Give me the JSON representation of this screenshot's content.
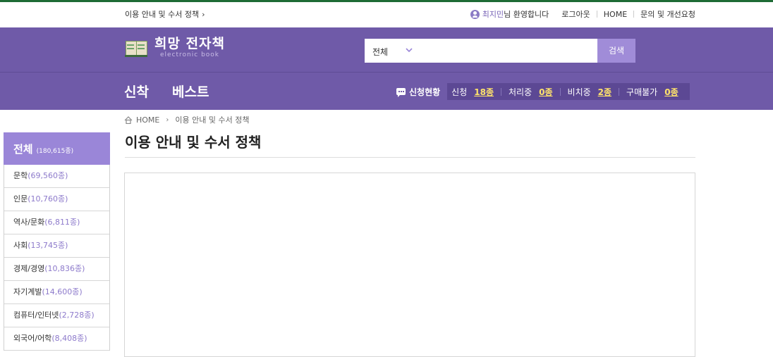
{
  "util": {
    "left_link": "이용 안내 및 수서 정책",
    "left_chevron": "›",
    "user_name": "최지민",
    "user_suffix": "님 환영합니다",
    "logout": "로그아웃",
    "home": "HOME",
    "inquiry": "문의 및 개선요청"
  },
  "header": {
    "logo_title": "희망 전자책",
    "logo_sub": "electronic book",
    "search_scope": "전체",
    "search_placeholder": "",
    "search_button": "검색"
  },
  "nav": {
    "items": [
      "신착",
      "베스트"
    ],
    "request_title": "신청현황",
    "stats": [
      {
        "label": "신청",
        "value": "18종"
      },
      {
        "label": "처리중",
        "value": "0종"
      },
      {
        "label": "비치중",
        "value": "2종"
      },
      {
        "label": "구매불가",
        "value": "0종"
      }
    ]
  },
  "breadcrumb": {
    "home": "HOME",
    "separator": "›",
    "current": "이용 안내 및 수서 정책"
  },
  "page": {
    "title": "이용 안내 및 수서 정책"
  },
  "sidebar": {
    "all_label": "전체",
    "all_count": "(180,615종)",
    "items": [
      {
        "label": "문학",
        "count": "(69,560종)"
      },
      {
        "label": "인문",
        "count": "(10,760종)"
      },
      {
        "label": "역사/문화",
        "count": "(6,811종)"
      },
      {
        "label": "사회",
        "count": "(13,745종)"
      },
      {
        "label": "경제/경영",
        "count": "(10,836종)"
      },
      {
        "label": "자기계발",
        "count": "(14,600종)"
      },
      {
        "label": "컴퓨터/인터넷",
        "count": "(2,728종)"
      },
      {
        "label": "외국어/어학",
        "count": "(8,408종)"
      }
    ]
  },
  "colors": {
    "brand": "#6f5aa8",
    "accent": "#9a86d8",
    "highlight": "#ffe36b",
    "topline": "#1e6b35"
  }
}
